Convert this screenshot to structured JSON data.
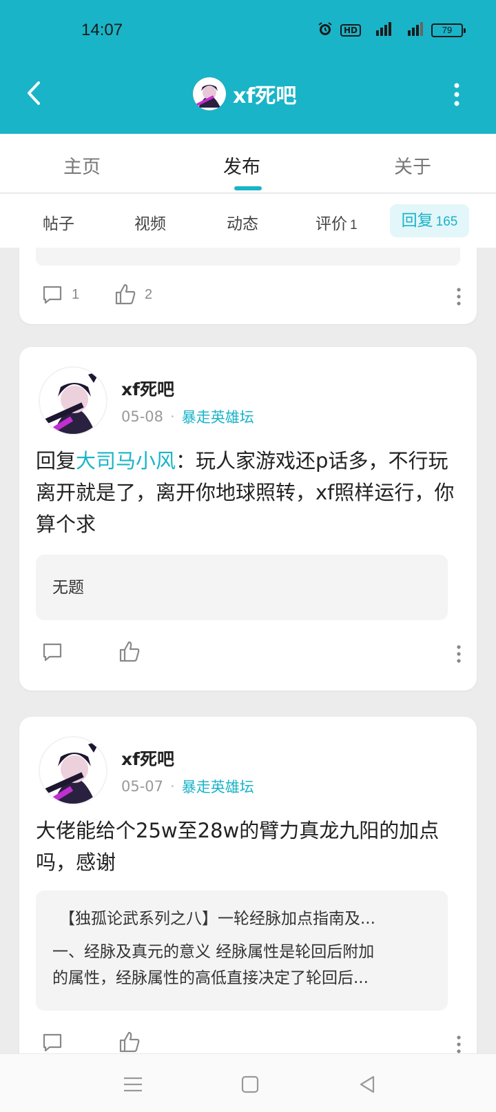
{
  "status_bar": {
    "time": "14:07",
    "hd": "HD",
    "signal1": "4G",
    "signal2": "4G",
    "battery": "79"
  },
  "header": {
    "title": "xf死吧"
  },
  "tabs": [
    {
      "label": "主页"
    },
    {
      "label": "发布"
    },
    {
      "label": "关于"
    }
  ],
  "subtabs": [
    {
      "label": "帖子"
    },
    {
      "label": "视频"
    },
    {
      "label": "动态"
    },
    {
      "label": "评价",
      "count": "1"
    },
    {
      "label": "回复",
      "count": "165"
    }
  ],
  "posts": [
    {
      "comments": "1",
      "likes": "2"
    },
    {
      "author": "xf死吧",
      "date": "05-08",
      "forum": "暴走英雄坛",
      "reply_prefix": "回复",
      "mention": "大司马小风",
      "text": "：玩人家游戏还p话多，不行玩离开就是了，离开你地球照转，xf照样运行，你算个求",
      "quote_title": "无题"
    },
    {
      "author": "xf死吧",
      "date": "05-07",
      "forum": "暴走英雄坛",
      "text": "大佬能给个25w至28w的臂力真龙九阳的加点吗，感谢",
      "quote_title": "【独孤论武系列之八】一轮经脉加点指南及...",
      "quote_line1": "一、经脉及真元的意义 经脉属性是轮回后附加",
      "quote_line2": "的属性，经脉属性的高低直接决定了轮回后..."
    }
  ]
}
